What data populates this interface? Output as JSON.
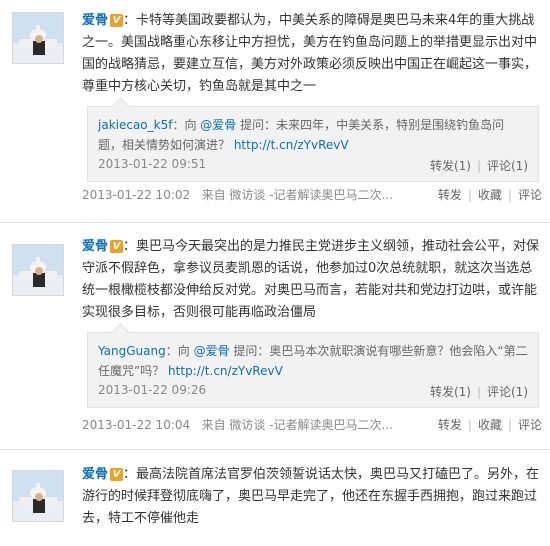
{
  "colors": {
    "author": "#0a6fb7",
    "link": "#0a6fb7",
    "badge": "#f0a020"
  },
  "posts": [
    {
      "author": "爱骨",
      "badge": "V",
      "text": "：卡特等美国政要都认为，中美关系的障碍是奥巴马未来4年的重大挑战之一。美国战略重心东移让中方担忧，美方在钓鱼岛问题上的举措更显示出对中国的战略猜忌，要建立互信，美方对外政策必须反映出中国正在崛起这一事实，尊重中方核心关切，钓鱼岛就是其中之一",
      "quote": {
        "user": "jakiecao_k5f",
        "prefix": "：向 ",
        "mention": "@爱骨",
        "body": " 提问：未来四年，中美关系，特别是围绕钓鱼岛问题，相关情势如何演进？ ",
        "url": "http://t.cn/zYvRevV",
        "time": "2013-01-22 09:51",
        "repost": "转发(1)",
        "comment": "评论(1)"
      },
      "time": "2013-01-22 10:02",
      "source": "来自 微访谈 -记者解读奥巴马二次...",
      "repost": "转发",
      "fav": "收藏",
      "comment": "评论"
    },
    {
      "author": "爱骨",
      "badge": "V",
      "text": "：奥巴马今天最突出的是力推民主党进步主义纲领，推动社会公平，对保守派不假辞色，拿参议员麦凯恩的话说，他参加过0次总统就职，就这次当选总统一根橄榄枝都没伸给反对党。对奥巴马而言，若能对共和党边打边哄，或许能实现很多目标，否则很可能再临政治僵局",
      "quote": {
        "user": "YangGuang",
        "prefix": "：向 ",
        "mention": "@爱骨",
        "body": " 提问：奥巴马本次就职演说有哪些新意？他会陷入“第二任魔咒”吗？ ",
        "url": "http://t.cn/zYvRevV",
        "time": "2013-01-22 09:26",
        "repost": "转发(1)",
        "comment": "评论(1)"
      },
      "time": "2013-01-22 10:04",
      "source": "来自 微访谈 -记者解读奥巴马二次...",
      "repost": "转发",
      "fav": "收藏",
      "comment": "评论"
    },
    {
      "author": "爱骨",
      "badge": "V",
      "text": "：最高法院首席法官罗伯茨领誓说话太快，奥巴马又打磕巴了。另外，在游行的时候拜登彻底嗨了，奥巴马早走完了，他还在东握手西拥抱，跑过来跑过去，特工不停催他走"
    }
  ]
}
